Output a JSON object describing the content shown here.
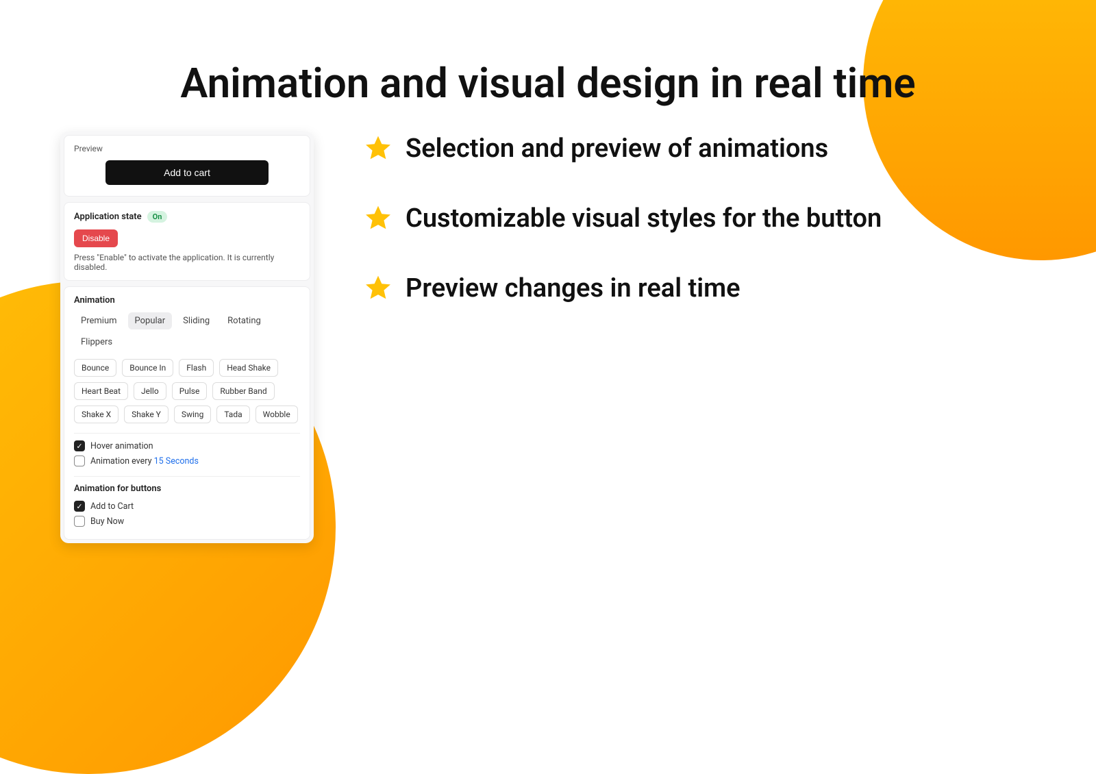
{
  "headline": "Animation and visual design in real time",
  "bullets": [
    "Selection and preview of animations",
    "Customizable visual styles for the button",
    "Preview changes in real time"
  ],
  "panel": {
    "preview": {
      "label": "Preview",
      "button_label": "Add to cart"
    },
    "state": {
      "title": "Application state",
      "badge": "On",
      "toggle_label": "Disable",
      "help": "Press \"Enable\" to activate the application. It is currently disabled."
    },
    "animation": {
      "title": "Animation",
      "tabs": [
        "Premium",
        "Popular",
        "Sliding",
        "Rotating",
        "Flippers"
      ],
      "active_tab": "Popular",
      "options": [
        "Bounce",
        "Bounce In",
        "Flash",
        "Head Shake",
        "Heart Beat",
        "Jello",
        "Pulse",
        "Rubber Band",
        "Shake X",
        "Shake Y",
        "Swing",
        "Tada",
        "Wobble"
      ],
      "hover_label": "Hover animation",
      "hover_checked": true,
      "interval_prefix": "Animation every ",
      "interval_value": "15 Seconds",
      "interval_checked": false
    },
    "buttons_section": {
      "title": "Animation for buttons",
      "items": [
        {
          "label": "Add to Cart",
          "checked": true
        },
        {
          "label": "Buy Now",
          "checked": false
        }
      ]
    }
  }
}
